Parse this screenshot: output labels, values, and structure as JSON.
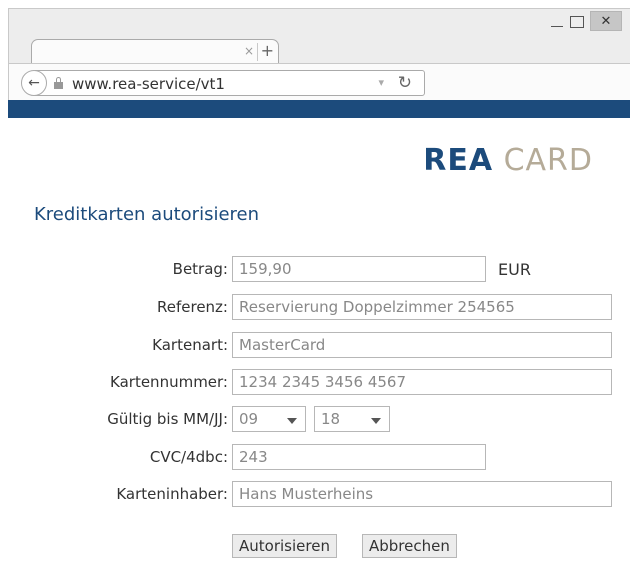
{
  "browser": {
    "url": "www.rea-service/vt1",
    "close_glyph": "✕",
    "tab_close_glyph": "×",
    "new_tab_glyph": "+",
    "back_glyph": "←",
    "reload_glyph": "↻",
    "dropdown_glyph": "▾"
  },
  "brand": {
    "part1": "REA",
    "part2": "CARD"
  },
  "page": {
    "title": "Kreditkarten autorisieren"
  },
  "form": {
    "amount_label": "Betrag:",
    "amount_value": "159,90",
    "currency": "EUR",
    "reference_label": "Referenz:",
    "reference_value": "Reservierung Doppelzimmer 254565",
    "card_type_label": "Kartenart:",
    "card_type_value": "MasterCard",
    "card_number_label": "Kartennummer:",
    "card_number_value": "1234 2345 3456 4567",
    "expiry_label": "Gültig bis MM/JJ:",
    "expiry_month": "09",
    "expiry_year": "18",
    "cvc_label": "CVC/4dbc:",
    "cvc_value": "243",
    "holder_label": "Karteninhaber:",
    "holder_value": "Hans Musterheins"
  },
  "actions": {
    "authorize": "Autorisieren",
    "cancel": "Abbrechen"
  },
  "colors": {
    "brand_blue": "#1c4b7c",
    "brand_beige": "#b5ab98"
  }
}
